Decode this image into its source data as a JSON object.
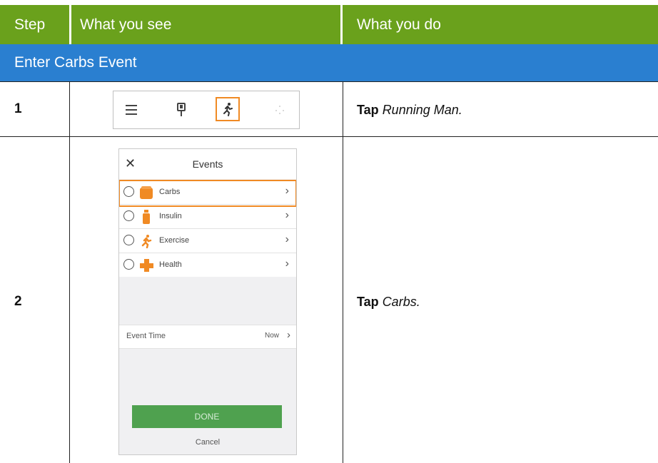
{
  "header": {
    "step": "Step",
    "what_you_see": "What you see",
    "what_you_do": "What you do",
    "bg_color": "#6aa11c"
  },
  "section": {
    "title": "Enter Carbs Event",
    "bg_color": "#2a7fd0"
  },
  "rows": [
    {
      "step": "1",
      "action_verb": "Tap",
      "action_target": "Running Man."
    },
    {
      "step": "2",
      "action_verb": "Tap",
      "action_target": "Carbs."
    }
  ],
  "toolbar_image": {
    "icons": [
      "menu-icon",
      "sensor-icon",
      "running-man-icon",
      "dots-icon"
    ],
    "highlight_color": "#f08a24"
  },
  "phone_screen": {
    "title": "Events",
    "close_icon": "close-icon",
    "event_items": [
      {
        "label": "Carbs",
        "icon": "carbs-icon",
        "highlighted": true
      },
      {
        "label": "Insulin",
        "icon": "insulin-icon",
        "highlighted": false
      },
      {
        "label": "Exercise",
        "icon": "exercise-icon",
        "highlighted": false
      },
      {
        "label": "Health",
        "icon": "health-icon",
        "highlighted": false
      }
    ],
    "event_time_label": "Event Time",
    "event_time_value": "Now",
    "done_button": "DONE",
    "cancel_link": "Cancel",
    "done_color": "#4fa14f"
  }
}
